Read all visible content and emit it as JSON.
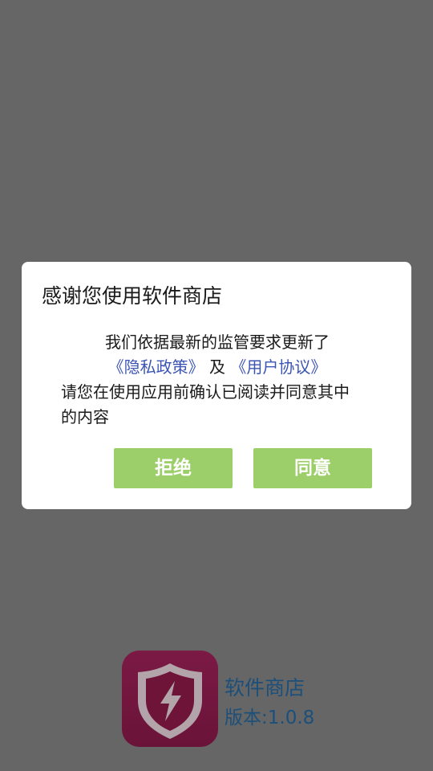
{
  "dialog": {
    "title": "感谢您使用软件商店",
    "body_line1": "我们依据最新的监管要求更新了",
    "privacy_link": "《隐私政策》",
    "and_text": "及",
    "agreement_link": "《用户协议》",
    "body_line3": "请您在使用应用前确认已阅读并同意其中",
    "body_line4": "的内容",
    "reject_label": "拒绝",
    "agree_label": "同意"
  },
  "splash": {
    "app_icon": "shield-lightning-icon",
    "app_name": "软件商店",
    "version": "版本:1.0.8"
  },
  "colors": {
    "overlay": "#666666",
    "button": "#9ccf6a",
    "link": "#3c55b4",
    "brand_text": "#1c4f7a",
    "icon_bg": "#7b1a45"
  }
}
